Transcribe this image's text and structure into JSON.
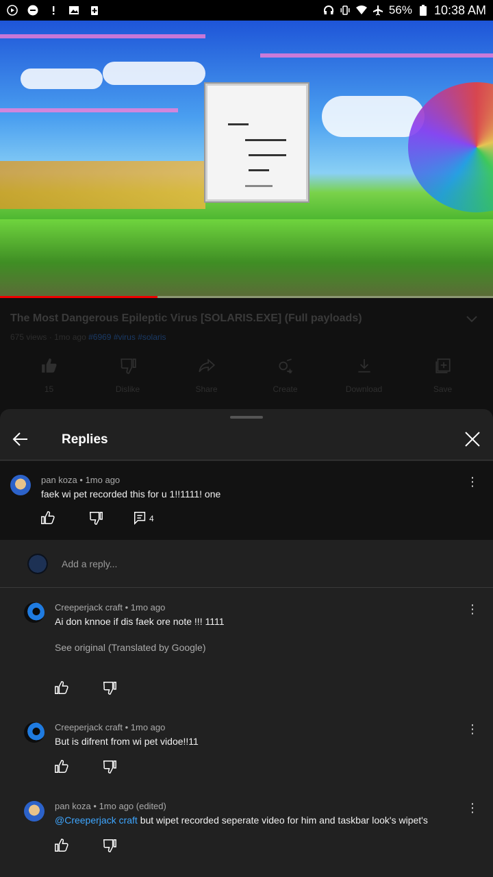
{
  "status_bar": {
    "battery": "56%",
    "time": "10:38 AM"
  },
  "video": {
    "progress": 0.32,
    "window_text": "HI\nMUT..\nWI\nKA"
  },
  "info": {
    "title": "The Most Dangerous Epileptic Virus [SOLARIS.EXE] (Full payloads)",
    "views": "675 views",
    "age": "1mo ago",
    "tags": [
      "#6969",
      "#virus",
      "#solaris"
    ],
    "actions": [
      {
        "icon": "thumbs-up-icon",
        "label": "15"
      },
      {
        "icon": "thumbs-down-icon",
        "label": "Dislike"
      },
      {
        "icon": "share-icon",
        "label": "Share"
      },
      {
        "icon": "create-icon",
        "label": "Create"
      },
      {
        "icon": "download-icon",
        "label": "Download"
      },
      {
        "icon": "save-icon",
        "label": "Save"
      }
    ]
  },
  "replies": {
    "title": "Replies",
    "input_placeholder": "Add a reply...",
    "parent": {
      "author": "pan koza",
      "age": "1mo ago",
      "text": "faek wi pet recorded this for u 1!!1111! one",
      "reply_count": "4"
    },
    "items": [
      {
        "author": "Creeperjack craft",
        "age": "1mo ago",
        "text": "Ai don knnoe if dis faek ore note !!! 1111",
        "translation_note": "See original (Translated by Google)"
      },
      {
        "author": "Creeperjack craft",
        "age": "1mo ago",
        "text": "But is difrent from wi pet vidoe!!11"
      },
      {
        "author": "pan koza",
        "age": "1mo ago (edited)",
        "mention": "@Creeperjack craft",
        "text": "but wipet recorded seperate video for him and taskbar look's wipet's"
      }
    ]
  },
  "colors": {
    "sheet_bg": "#212121",
    "parent_bg": "#121212",
    "accent_link": "#3ea6ff",
    "progress_red": "#e00000"
  }
}
